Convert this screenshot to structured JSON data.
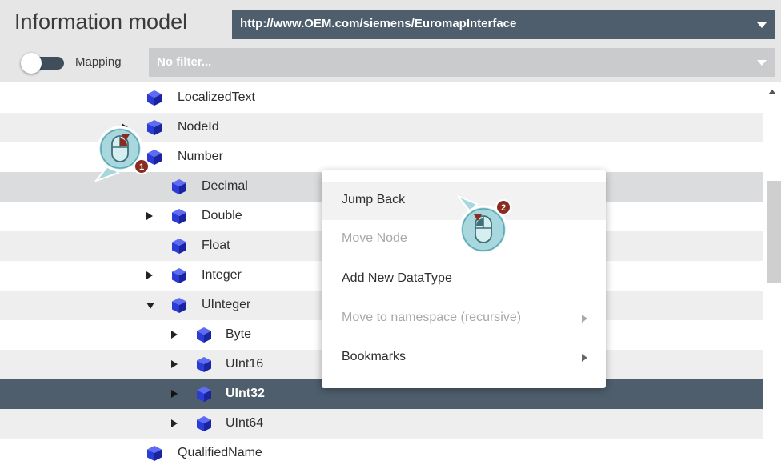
{
  "header": {
    "title": "Information model",
    "namespace_value": "http://www.OEM.com/siemens/EuromapInterface",
    "mapping_label": "Mapping",
    "mapping_enabled": false,
    "filter_placeholder": "No filter..."
  },
  "tree": {
    "rows": [
      {
        "label": "LocalizedText",
        "expander": "none"
      },
      {
        "label": "NodeId",
        "expander": "collapsed"
      },
      {
        "label": "Number",
        "expander": "expanded"
      },
      {
        "label": "Decimal",
        "expander": "none"
      },
      {
        "label": "Double",
        "expander": "collapsed"
      },
      {
        "label": "Float",
        "expander": "none"
      },
      {
        "label": "Integer",
        "expander": "collapsed"
      },
      {
        "label": "UInteger",
        "expander": "expanded"
      },
      {
        "label": "Byte",
        "expander": "collapsed"
      },
      {
        "label": "UInt16",
        "expander": "collapsed"
      },
      {
        "label": "UInt32",
        "expander": "collapsed",
        "selected": true
      },
      {
        "label": "UInt64",
        "expander": "collapsed"
      },
      {
        "label": "QualifiedName",
        "expander": "none"
      }
    ]
  },
  "context_menu": {
    "items": [
      {
        "label": "Jump Back",
        "enabled": true,
        "submenu": false
      },
      {
        "label": "Move Node",
        "enabled": false,
        "submenu": false
      },
      {
        "label": "Add New DataType",
        "enabled": true,
        "submenu": false
      },
      {
        "label": "Move to namespace (recursive)",
        "enabled": false,
        "submenu": true
      },
      {
        "label": "Bookmarks",
        "enabled": true,
        "submenu": true
      }
    ]
  },
  "callouts": [
    {
      "number": "1",
      "icon": "right-mouse-click-icon"
    },
    {
      "number": "2",
      "icon": "left-mouse-click-icon"
    }
  ],
  "colors": {
    "header_bg": "#e6e6e6",
    "select_bg": "#4e5e6c",
    "filter_bg": "#c9cbcc",
    "selected_row": "#4e5e6c",
    "cube_blue": "#2b3bd6",
    "callout_fill": "#a8d8de",
    "callout_badge": "#8b2a1e"
  }
}
